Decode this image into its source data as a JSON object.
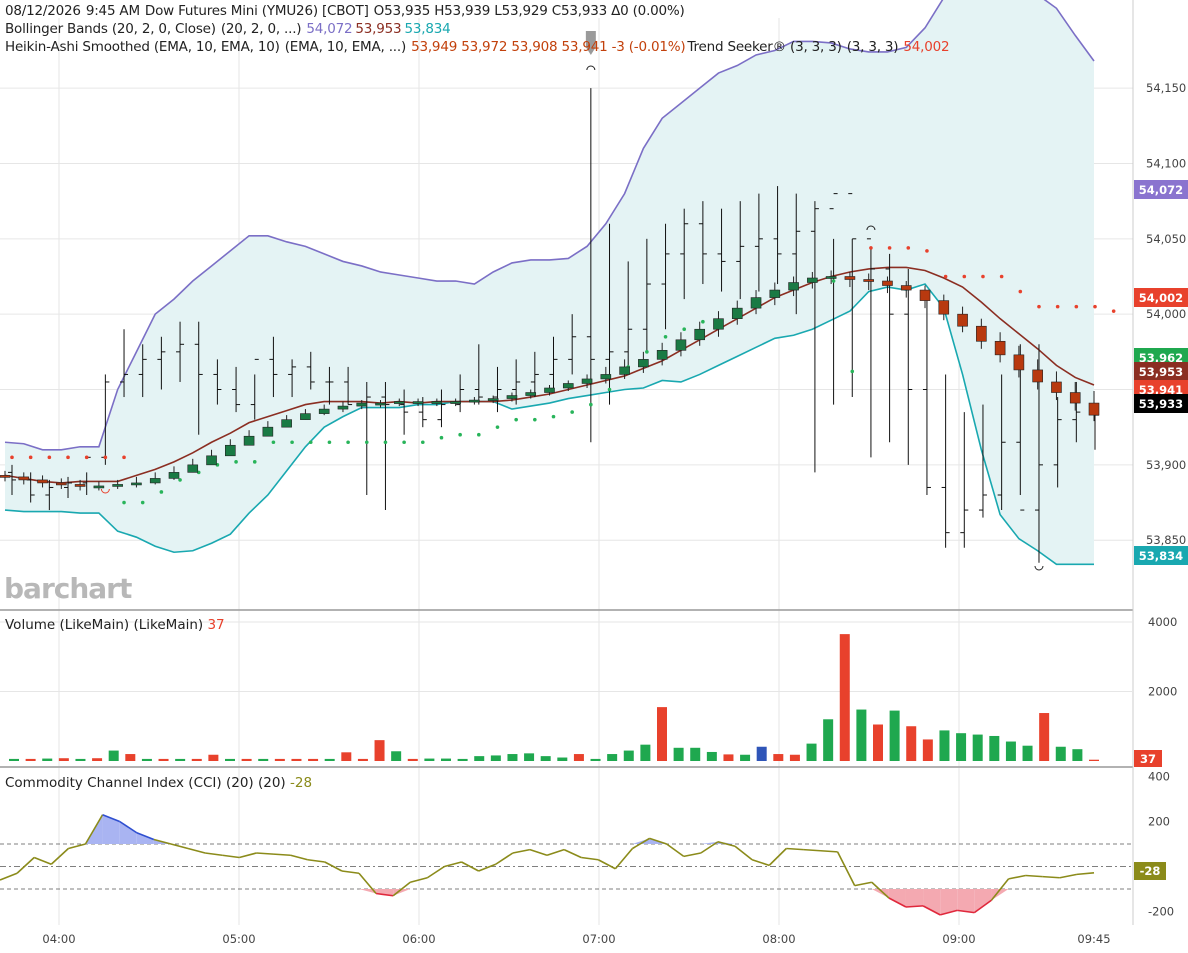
{
  "header": {
    "line1": {
      "date": "08/12/2026",
      "time": "9:45 AM",
      "name": "Dow Futures Mini (YMU26) [CBOT]",
      "ohlc": "O53,935 H53,939 L53,929 C53,933 Δ0 (0.00%)"
    },
    "bollinger": {
      "label": "Bollinger Bands (20, 2, 0, Close)",
      "params": "(20, 2, 0, ...)",
      "upper": "54,072",
      "middle": "53,953",
      "lower": "53,834"
    },
    "heikin": {
      "label": "Heikin-Ashi Smoothed (EMA, 10, EMA, 10)",
      "params": "(EMA, 10, EMA, ...)",
      "values": "53,949 53,972 53,908 53,941 -3 (-0.01%)"
    },
    "trend": {
      "label": "Trend Seeker® (3, 3, 3)",
      "params": "(3, 3, 3)",
      "value": "54,002"
    }
  },
  "watermark": "barchart",
  "volume_pane": {
    "title": "Volume (LikeMain)",
    "params": "(LikeMain)",
    "value": "37"
  },
  "cci_pane": {
    "title": "Commodity Channel Index (CCI) (20)",
    "params": "(20)",
    "value": "-28"
  },
  "colors": {
    "up": "#1f9d4a",
    "down": "#e8412c",
    "bb_upper": "#7b6fc6",
    "bb_lower": "#19a8b0",
    "bb_mid": "#8b2e22",
    "bb_fill": "#e4f3f4",
    "trend_bull": "#28b45a",
    "trend_bear": "#e8412c",
    "ha_up": "#1a7a44",
    "ha_down": "#b8390f",
    "cci_line": "#8b8b1a",
    "cci_over": "#2f4fd0",
    "cci_under": "#e0283c"
  },
  "price_tags": [
    {
      "value": "54,072",
      "color": "#8a74cf"
    },
    {
      "value": "54,002",
      "color": "#e8412c"
    },
    {
      "value": "53,962",
      "color": "#1fa84f"
    },
    {
      "value": "53,953",
      "color": "#8b2e22"
    },
    {
      "value": "53,941",
      "color": "#e8412c"
    },
    {
      "value": "53,933",
      "color": "#000000"
    },
    {
      "value": "53,834",
      "color": "#19a8b0"
    }
  ],
  "volume_tag": {
    "value": "37",
    "color": "#e8412c"
  },
  "cci_tag": {
    "value": "-28",
    "color": "#8b8b1a"
  },
  "chart_data": {
    "type": "line",
    "symbol": "YMU26",
    "price_axis": {
      "ticks": [
        "54,150",
        "54,100",
        "54,050",
        "54,000",
        "53,950",
        "53,900",
        "53,850"
      ],
      "range": [
        53805,
        54170
      ]
    },
    "time_axis": {
      "ticks": [
        "04:00",
        "05:00",
        "06:00",
        "07:00",
        "08:00",
        "09:00",
        "09:45"
      ]
    },
    "volume_axis": {
      "ticks": [
        "4000",
        "2000"
      ],
      "range": [
        0,
        4200
      ]
    },
    "cci_axis": {
      "ticks": [
        "400",
        "200",
        "-200"
      ],
      "range": [
        -260,
        420
      ],
      "bands": [
        100,
        0,
        -100
      ]
    },
    "bollinger": {
      "upper": [
        53915,
        53914,
        53910,
        53910,
        53912,
        53912,
        53950,
        53975,
        54000,
        54010,
        54022,
        54032,
        54042,
        54052,
        54052,
        54048,
        54045,
        54040,
        54035,
        54032,
        54028,
        54026,
        54024,
        54022,
        54022,
        54020,
        54028,
        54034,
        54036,
        54036,
        54037,
        54045,
        54060,
        54080,
        54110,
        54130,
        54140,
        54150,
        54160,
        54165,
        54172,
        54175,
        54181,
        54181,
        54180,
        54176,
        54174,
        54174,
        54177,
        54190,
        54210,
        54228,
        54234,
        54228,
        54220,
        54212,
        54203,
        54185,
        54168
      ],
      "middle": [
        53893,
        53891,
        53889,
        53888,
        53889,
        53889,
        53889,
        53893,
        53897,
        53902,
        53908,
        53915,
        53921,
        53928,
        53932,
        53936,
        53940,
        53942,
        53942,
        53942,
        53941,
        53942,
        53941,
        53942,
        53942,
        53942,
        53942,
        53943,
        53945,
        53947,
        53950,
        53953,
        53956,
        53959,
        53964,
        53969,
        53976,
        53983,
        53990,
        53997,
        54004,
        54011,
        54016,
        54021,
        54025,
        54028,
        54030,
        54031,
        54031,
        54029,
        54024,
        54018,
        54008,
        53997,
        53987,
        53977,
        53966,
        53958,
        53953
      ],
      "lower": [
        53870,
        53869,
        53869,
        53869,
        53868,
        53868,
        53856,
        53852,
        53846,
        53842,
        53843,
        53848,
        53854,
        53868,
        53880,
        53896,
        53912,
        53925,
        53932,
        53938,
        53938,
        53938,
        53940,
        53940,
        53942,
        53942,
        53942,
        53937,
        53939,
        53941,
        53944,
        53946,
        53948,
        53950,
        53951,
        53956,
        53955,
        53960,
        53966,
        53972,
        53978,
        53984,
        53986,
        53990,
        53996,
        54002,
        54015,
        54018,
        54016,
        54020,
        54004,
        53960,
        53910,
        53867,
        53851,
        53843,
        53834,
        53834,
        53834
      ]
    },
    "ha_smoothed": {
      "open": [
        53893,
        53892,
        53890,
        53888,
        53887,
        53886,
        53886,
        53887,
        53888,
        53891,
        53895,
        53900,
        53906,
        53913,
        53919,
        53925,
        53930,
        53934,
        53937,
        53939,
        53941,
        53941,
        53942,
        53942,
        53942,
        53942,
        53943,
        53944,
        53946,
        53948,
        53951,
        53954,
        53957,
        53960,
        53965,
        53970,
        53976,
        53983,
        53990,
        53997,
        54004,
        54011,
        54016,
        54021,
        54024,
        54025,
        54023,
        54022,
        54019,
        54016,
        54009,
        54000,
        53992,
        53982,
        53973,
        53963,
        53955,
        53948,
        53941
      ],
      "close": [
        53892,
        53890,
        53888,
        53887,
        53886,
        53886,
        53887,
        53888,
        53891,
        53895,
        53900,
        53906,
        53913,
        53919,
        53925,
        53930,
        53934,
        53937,
        53939,
        53941,
        53941,
        53942,
        53942,
        53942,
        53942,
        53943,
        53944,
        53946,
        53948,
        53951,
        53954,
        53957,
        53960,
        53965,
        53970,
        53976,
        53983,
        53990,
        53997,
        54004,
        54011,
        54016,
        54021,
        54024,
        54025,
        54023,
        54022,
        54019,
        54016,
        54009,
        54000,
        53992,
        53982,
        53973,
        53963,
        53955,
        53948,
        53941,
        53933
      ],
      "high": [
        53896,
        53895,
        53893,
        53891,
        53890,
        53889,
        53890,
        53892,
        53895,
        53899,
        53904,
        53910,
        53917,
        53923,
        53929,
        53933,
        53937,
        53940,
        53942,
        53943,
        53943,
        53944,
        53944,
        53944,
        53944,
        53945,
        53946,
        53948,
        53950,
        53953,
        53956,
        53960,
        53965,
        53970,
        53975,
        53981,
        53988,
        53995,
        54002,
        54009,
        54016,
        54021,
        54025,
        54028,
        54029,
        54028,
        54027,
        54025,
        54022,
        54019,
        54013,
        54005,
        53997,
        53988,
        53979,
        53970,
        53962,
        53955,
        53949
      ],
      "low": [
        53889,
        53887,
        53885,
        53884,
        53883,
        53883,
        53884,
        53885,
        53887,
        53890,
        53895,
        53901,
        53908,
        53914,
        53920,
        53926,
        53930,
        53933,
        53935,
        53937,
        53938,
        53939,
        53939,
        53939,
        53939,
        53940,
        53941,
        53942,
        53944,
        53946,
        53949,
        53951,
        53954,
        53957,
        53961,
        53966,
        53972,
        53979,
        53985,
        53993,
        54000,
        54006,
        54012,
        54017,
        54020,
        54018,
        54016,
        54014,
        54011,
        54004,
        53996,
        53988,
        53977,
        53968,
        53958,
        53950,
        53943,
        53936,
        53929
      ]
    },
    "ohlc_bars": {
      "open": [
        53895,
        53890,
        53880,
        53885,
        53888,
        53905,
        53955,
        53960,
        53970,
        53975,
        53980,
        53960,
        53950,
        53940,
        53970,
        53960,
        53965,
        53955,
        53955,
        53940,
        53945,
        53940,
        53935,
        53930,
        53940,
        53950,
        53945,
        53950,
        53955,
        53960,
        53970,
        53985,
        53970,
        53975,
        53990,
        54020,
        54040,
        54060,
        54040,
        54035,
        54045,
        54050,
        54040,
        54055,
        54070,
        54080,
        54050,
        54030,
        54000,
        53950,
        53885,
        53855,
        53870,
        53880,
        53915,
        53870,
        53900,
        53930,
        53935
      ],
      "high": [
        53900,
        53895,
        53890,
        53892,
        53895,
        53960,
        53990,
        53980,
        53985,
        53995,
        53995,
        53970,
        53965,
        53960,
        53985,
        53970,
        53975,
        53965,
        53965,
        53955,
        53955,
        53950,
        53945,
        53950,
        53960,
        53980,
        53965,
        53970,
        53975,
        53985,
        54000,
        54150,
        54060,
        54035,
        54050,
        54060,
        54070,
        54075,
        54070,
        54075,
        54080,
        54085,
        54080,
        54075,
        54050,
        54050,
        54045,
        54040,
        54030,
        54010,
        53960,
        53935,
        53940,
        53960,
        53980,
        53980,
        53945,
        53955,
        53939
      ],
      "low": [
        53880,
        53875,
        53870,
        53878,
        53880,
        53900,
        53945,
        53945,
        53950,
        53955,
        53920,
        53940,
        53935,
        53930,
        53945,
        53945,
        53950,
        53940,
        53940,
        53880,
        53870,
        53920,
        53925,
        53925,
        53935,
        53940,
        53935,
        53940,
        53945,
        53950,
        53960,
        53915,
        53940,
        53960,
        53975,
        53990,
        54010,
        54020,
        54015,
        54010,
        54015,
        54020,
        54000,
        53895,
        53940,
        53945,
        53905,
        53915,
        53900,
        53880,
        53845,
        53845,
        53865,
        53870,
        53880,
        53835,
        53885,
        53915,
        53910
      ],
      "close": [
        53890,
        53880,
        53885,
        53888,
        53905,
        53955,
        53960,
        53970,
        53975,
        53980,
        53960,
        53950,
        53940,
        53970,
        53960,
        53965,
        53955,
        53955,
        53940,
        53945,
        53940,
        53935,
        53930,
        53940,
        53950,
        53945,
        53950,
        53955,
        53960,
        53970,
        53985,
        53970,
        53975,
        53990,
        54020,
        54040,
        54060,
        54040,
        54035,
        54045,
        54050,
        54040,
        54055,
        54070,
        54080,
        54050,
        54030,
        54000,
        53950,
        53885,
        53855,
        53870,
        53880,
        53915,
        53870,
        53900,
        53930,
        53935,
        53933
      ]
    },
    "trend_seeker": {
      "bear": [
        [
          0,
          53905
        ],
        [
          1,
          53905
        ],
        [
          2,
          53905
        ],
        [
          3,
          53905
        ],
        [
          4,
          53905
        ],
        [
          5,
          53905
        ],
        [
          6,
          53905
        ],
        [
          46,
          54044
        ],
        [
          47,
          54044
        ],
        [
          48,
          54044
        ],
        [
          49,
          54042
        ],
        [
          50,
          54025
        ],
        [
          51,
          54025
        ],
        [
          52,
          54025
        ],
        [
          53,
          54025
        ],
        [
          54,
          54015
        ],
        [
          55,
          54005
        ],
        [
          56,
          54005
        ],
        [
          57,
          54005
        ],
        [
          58,
          54005
        ],
        [
          59,
          54002
        ]
      ],
      "bull": [
        [
          6,
          53875
        ],
        [
          7,
          53875
        ],
        [
          8,
          53882
        ],
        [
          9,
          53890
        ],
        [
          10,
          53895
        ],
        [
          11,
          53900
        ],
        [
          12,
          53902
        ],
        [
          13,
          53902
        ],
        [
          14,
          53915
        ],
        [
          15,
          53915
        ],
        [
          16,
          53915
        ],
        [
          17,
          53915
        ],
        [
          18,
          53915
        ],
        [
          19,
          53915
        ],
        [
          20,
          53915
        ],
        [
          21,
          53915
        ],
        [
          22,
          53915
        ],
        [
          23,
          53918
        ],
        [
          24,
          53920
        ],
        [
          25,
          53920
        ],
        [
          26,
          53925
        ],
        [
          27,
          53930
        ],
        [
          28,
          53930
        ],
        [
          29,
          53932
        ],
        [
          30,
          53935
        ],
        [
          31,
          53940
        ],
        [
          32,
          53950
        ],
        [
          33,
          53965
        ],
        [
          34,
          53975
        ],
        [
          35,
          53985
        ],
        [
          36,
          53990
        ],
        [
          37,
          53995
        ],
        [
          38,
          53995
        ],
        [
          39,
          54000
        ],
        [
          40,
          54010
        ],
        [
          41,
          54015
        ],
        [
          42,
          54020
        ],
        [
          43,
          54022
        ],
        [
          44,
          54022
        ],
        [
          45,
          53962
        ]
      ]
    },
    "volume": [
      [
        60,
        "up"
      ],
      [
        60,
        "down"
      ],
      [
        70,
        "up"
      ],
      [
        80,
        "down"
      ],
      [
        60,
        "up"
      ],
      [
        80,
        "down"
      ],
      [
        300,
        "up"
      ],
      [
        200,
        "down"
      ],
      [
        60,
        "up"
      ],
      [
        60,
        "down"
      ],
      [
        60,
        "up"
      ],
      [
        60,
        "down"
      ],
      [
        180,
        "down"
      ],
      [
        60,
        "up"
      ],
      [
        60,
        "down"
      ],
      [
        60,
        "up"
      ],
      [
        60,
        "down"
      ],
      [
        60,
        "down"
      ],
      [
        60,
        "down"
      ],
      [
        60,
        "up"
      ],
      [
        250,
        "down"
      ],
      [
        60,
        "down"
      ],
      [
        600,
        "down"
      ],
      [
        280,
        "up"
      ],
      [
        60,
        "down"
      ],
      [
        70,
        "up"
      ],
      [
        70,
        "up"
      ],
      [
        60,
        "up"
      ],
      [
        140,
        "up"
      ],
      [
        160,
        "up"
      ],
      [
        200,
        "up"
      ],
      [
        220,
        "up"
      ],
      [
        140,
        "up"
      ],
      [
        100,
        "up"
      ],
      [
        200,
        "down"
      ],
      [
        60,
        "up"
      ],
      [
        200,
        "up"
      ],
      [
        300,
        "up"
      ],
      [
        470,
        "up"
      ],
      [
        1550,
        "down"
      ],
      [
        380,
        "up"
      ],
      [
        380,
        "up"
      ],
      [
        260,
        "up"
      ],
      [
        190,
        "down"
      ],
      [
        180,
        "up"
      ],
      [
        410,
        "blue"
      ],
      [
        200,
        "down"
      ],
      [
        180,
        "down"
      ],
      [
        500,
        "up"
      ],
      [
        1200,
        "up"
      ],
      [
        3650,
        "down"
      ],
      [
        1480,
        "up"
      ],
      [
        1050,
        "down"
      ],
      [
        1450,
        "up"
      ],
      [
        1000,
        "down"
      ],
      [
        620,
        "down"
      ],
      [
        880,
        "up"
      ],
      [
        800,
        "up"
      ],
      [
        760,
        "up"
      ],
      [
        720,
        "up"
      ],
      [
        560,
        "up"
      ],
      [
        440,
        "up"
      ],
      [
        1380,
        "down"
      ],
      [
        410,
        "up"
      ],
      [
        340,
        "up"
      ],
      [
        37,
        "down"
      ]
    ],
    "cci": [
      -60,
      -30,
      40,
      10,
      80,
      100,
      230,
      200,
      150,
      120,
      100,
      80,
      60,
      50,
      40,
      60,
      55,
      50,
      30,
      20,
      -20,
      -30,
      -120,
      -130,
      -70,
      -50,
      0,
      20,
      -20,
      10,
      60,
      75,
      50,
      75,
      40,
      30,
      -10,
      80,
      125,
      100,
      45,
      60,
      110,
      90,
      30,
      5,
      80,
      75,
      70,
      65,
      -85,
      -70,
      -140,
      -180,
      -175,
      -215,
      -195,
      -205,
      -150,
      -55,
      -40,
      -45,
      -50,
      -35,
      -28
    ]
  }
}
